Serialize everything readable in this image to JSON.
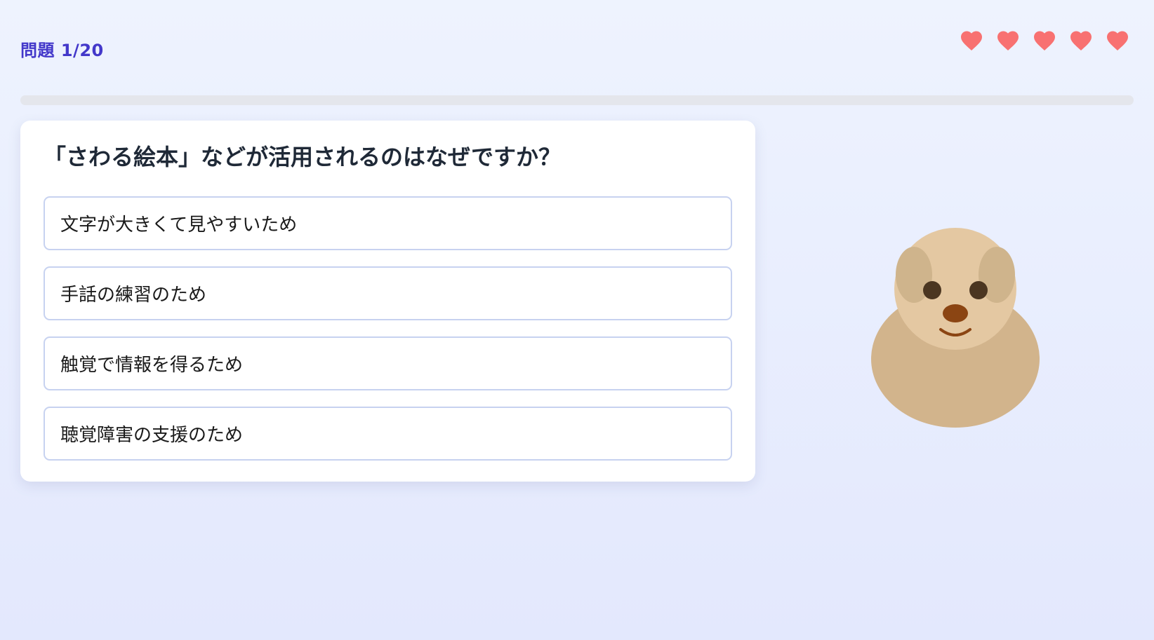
{
  "header": {
    "progress_label": "問題 1/20",
    "progress_fraction": 0.0,
    "lives": 5,
    "lives_icon": "heart-icon"
  },
  "colors": {
    "accent": "#4338ca",
    "heart": "#f87171",
    "option_border": "#c7d2f0",
    "mascot_body": "#d2b48c",
    "mascot_head": "#e4c8a2",
    "mascot_ear": "#cfb48c",
    "mascot_nose": "#8b4513",
    "mascot_eye": "#4b3621"
  },
  "question": {
    "text": "「さわる絵本」などが活用されるのはなぜですか？",
    "options": [
      {
        "label": "文字が大きくて見やすいため"
      },
      {
        "label": "手話の練習のため"
      },
      {
        "label": "触覚で情報を得るため"
      },
      {
        "label": "聴覚障害の支援のため"
      }
    ]
  },
  "mascot": {
    "icon": "dog-mascot"
  }
}
